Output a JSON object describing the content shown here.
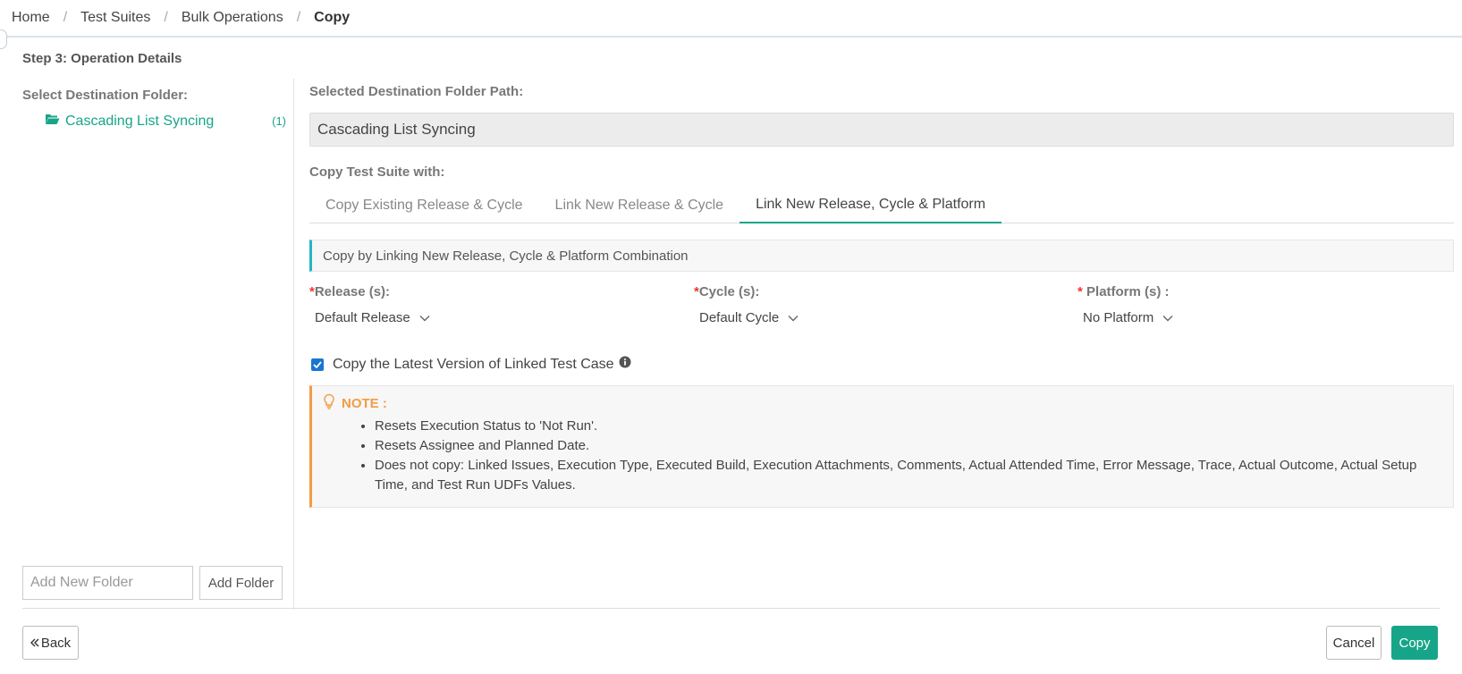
{
  "breadcrumb": {
    "items": [
      "Home",
      "Test Suites",
      "Bulk Operations"
    ],
    "current": "Copy"
  },
  "step_title": "Step 3: Operation Details",
  "left": {
    "label": "Select Destination Folder:",
    "folder": {
      "name": "Cascading List Syncing",
      "count": "(1)"
    },
    "add_folder_placeholder": "Add New Folder",
    "add_folder_button": "Add Folder"
  },
  "right": {
    "path_label": "Selected Destination Folder Path:",
    "path_value": "Cascading List Syncing",
    "copy_with_label": "Copy Test Suite with:",
    "tabs": [
      {
        "label": "Copy Existing Release & Cycle",
        "active": false
      },
      {
        "label": "Link New Release & Cycle",
        "active": false
      },
      {
        "label": "Link New Release, Cycle & Platform",
        "active": true
      }
    ],
    "info_text": "Copy by Linking New Release, Cycle & Platform Combination",
    "fields": {
      "release": {
        "required": "*",
        "label": "Release (s):",
        "value": "Default Release"
      },
      "cycle": {
        "required": "*",
        "label": "Cycle (s):",
        "value": "Default Cycle"
      },
      "platform": {
        "required": "* ",
        "label": "Platform (s) :",
        "value": "No Platform"
      }
    },
    "checkbox": {
      "label": "Copy the Latest Version of Linked Test Case",
      "checked": true
    },
    "note": {
      "title": "NOTE :",
      "items": [
        "Resets Execution Status to 'Not Run'.",
        "Resets Assignee and Planned Date.",
        "Does not copy: Linked Issues, Execution Type, Executed Build, Execution Attachments, Comments, Actual Attended Time, Error Message, Trace, Actual Outcome, Actual Setup Time, and Test Run UDFs Values."
      ]
    }
  },
  "footer": {
    "back": "Back",
    "cancel": "Cancel",
    "copy": "Copy"
  },
  "colors": {
    "accent": "#17a589",
    "info_border": "#26b5c0",
    "note_border": "#f39c45",
    "required": "#e53935",
    "checkbox": "#1976d2"
  }
}
